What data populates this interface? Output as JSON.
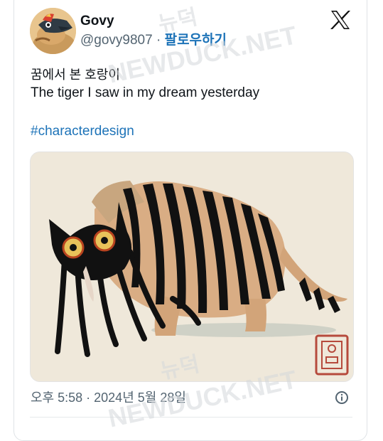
{
  "tweet": {
    "display_name": "Govy",
    "handle": "@govy9807",
    "separator": "·",
    "follow_label": "팔로우하기",
    "text_line1": "꿈에서 본 호랑이",
    "text_line2": "The tiger I saw in my dream yesterday",
    "hashtag": "#characterdesign",
    "timestamp": "오후 5:58 · 2024년 5월 28일"
  },
  "watermark": {
    "korean": "뉴덕",
    "english": "NEWDUCK.NET"
  },
  "icons": {
    "platform_logo": "x-logo-icon",
    "info": "info-icon",
    "avatar": "avatar-illustration",
    "artist_seal": "artist-seal-stamp"
  },
  "colors": {
    "link": "#1d73b8",
    "secondary_text": "#536471",
    "media_background": "#efe8da"
  }
}
